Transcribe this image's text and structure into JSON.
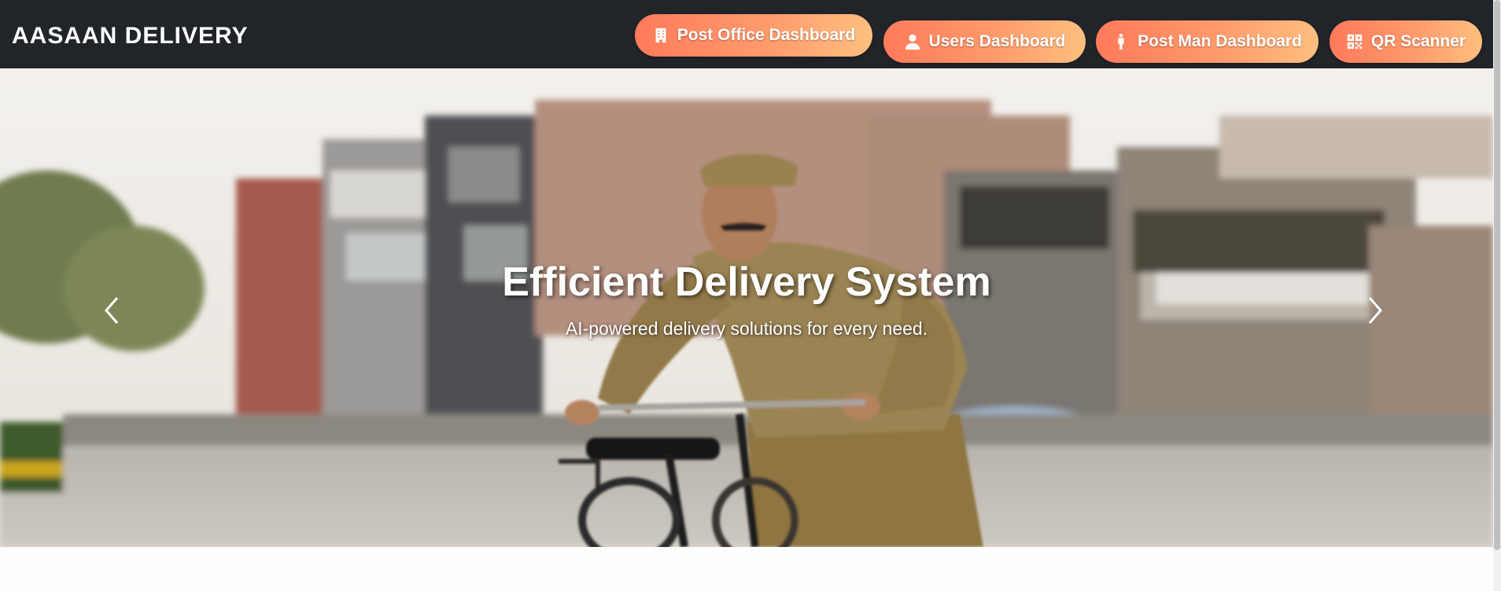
{
  "navbar": {
    "brand": "AASAAN DELIVERY",
    "buttons": [
      {
        "label": "Post Office Dashboard",
        "icon": "building-icon"
      },
      {
        "label": "Users Dashboard",
        "icon": "user-icon"
      },
      {
        "label": "Post Man Dashboard",
        "icon": "person-standing-icon"
      },
      {
        "label": "QR Scanner",
        "icon": "qr-code-icon"
      }
    ],
    "colors": {
      "background": "#212429",
      "button_gradient_start": "#ff7a5a",
      "button_gradient_end": "#ffbf80"
    }
  },
  "carousel": {
    "slide": {
      "title": "Efficient Delivery System",
      "subtitle": "AI-powered delivery solutions for every need.",
      "image_icon": "postman-with-bicycle-photo"
    },
    "prev_icon": "chevron-left-icon",
    "next_icon": "chevron-right-icon"
  }
}
